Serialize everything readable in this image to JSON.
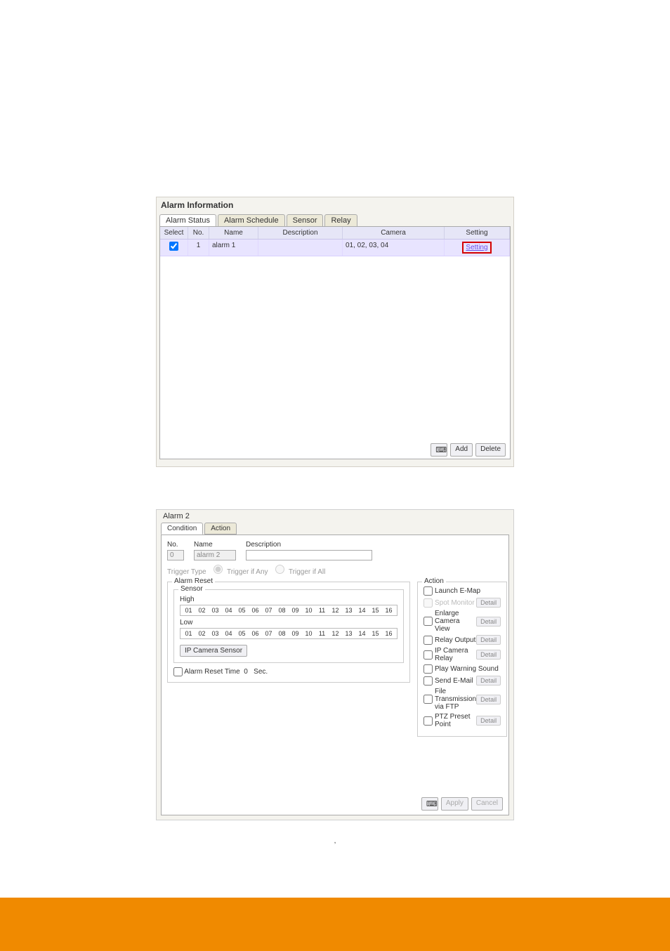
{
  "win1": {
    "title": "Alarm Information",
    "tabs": [
      "Alarm Status",
      "Alarm Schedule",
      "Sensor",
      "Relay"
    ],
    "active_tab": 0,
    "headers": {
      "select": "Select",
      "no": "No.",
      "name": "Name",
      "description": "Description",
      "camera": "Camera",
      "setting": "Setting"
    },
    "rows": [
      {
        "checked": true,
        "no": "1",
        "name": "alarm 1",
        "description": "",
        "camera": "01, 02, 03, 04",
        "setting_label": "Setting"
      }
    ],
    "buttons": {
      "keyboard_icon": "⌨",
      "add": "Add",
      "delete": "Delete"
    }
  },
  "win2": {
    "title": "Alarm 2",
    "tabs": [
      "Condition",
      "Action"
    ],
    "active_tab": 0,
    "labels": {
      "no": "No.",
      "name": "Name",
      "description": "Description",
      "trigger_type": "Trigger Type",
      "trigger_any": "Trigger if Any",
      "trigger_all": "Trigger if All",
      "alarm_reset": "Alarm Reset",
      "sensor": "Sensor",
      "high": "High",
      "low": "Low",
      "ip_camera_sensor": "IP Camera Sensor",
      "alarm_reset_time": "Alarm Reset Time",
      "sec": "Sec.",
      "action": "Action"
    },
    "values": {
      "no": "0",
      "name": "alarm 2",
      "description": "",
      "reset_time": "0"
    },
    "sensor_numbers": [
      "01",
      "02",
      "03",
      "04",
      "05",
      "06",
      "07",
      "08",
      "09",
      "10",
      "11",
      "12",
      "13",
      "14",
      "15",
      "16"
    ],
    "actions": [
      {
        "label": "Launch E-Map",
        "detail": false,
        "disabled": false
      },
      {
        "label": "Spot Monitor",
        "detail": true,
        "disabled": true
      },
      {
        "label": "Enlarge Camera View",
        "detail": true,
        "disabled": false
      },
      {
        "label": "Relay Output",
        "detail": true,
        "disabled": false
      },
      {
        "label": "IP Camera Relay",
        "detail": true,
        "disabled": false
      },
      {
        "label": "Play Warning Sound",
        "detail": false,
        "disabled": false
      },
      {
        "label": "Send E-Mail",
        "detail": true,
        "disabled": false
      },
      {
        "label": "File Transmission via FTP",
        "detail": true,
        "disabled": false
      },
      {
        "label": "PTZ Preset Point",
        "detail": true,
        "disabled": false
      }
    ],
    "buttons": {
      "keyboard_icon": "⌨",
      "apply": "Apply",
      "cancel": "Cancel",
      "detail": "Detail"
    }
  },
  "caption": {
    "comma": ","
  }
}
